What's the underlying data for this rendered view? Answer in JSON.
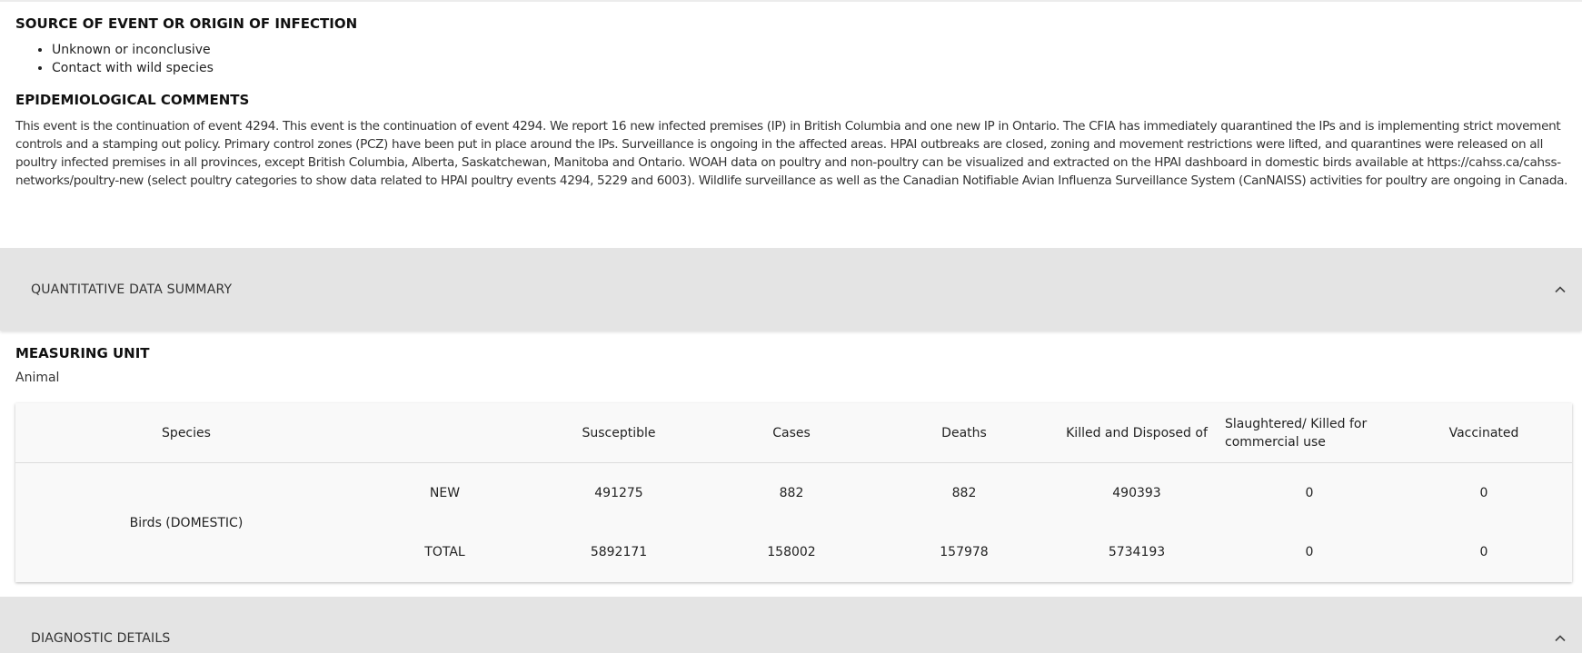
{
  "origin": {
    "title": "SOURCE OF EVENT OR ORIGIN OF INFECTION",
    "items": [
      "Unknown or inconclusive",
      "Contact with wild species"
    ]
  },
  "epidemiology": {
    "title": "EPIDEMIOLOGICAL COMMENTS",
    "text": "This event is the continuation of event 4294. This event is the continuation of event 4294. We report 16 new infected premises (IP) in British Columbia and one new IP in Ontario. The CFIA has immediately quarantined the IPs and is implementing strict movement controls and a stamping out policy. Primary control zones (PCZ) have been put in place around the IPs. Surveillance is ongoing in the affected areas. HPAI outbreaks are closed, zoning and movement restrictions were lifted, and quarantines were released on all poultry infected premises in all provinces, except British Columbia, Alberta, Saskatchewan, Manitoba and Ontario. WOAH data on poultry and non-poultry can be visualized and extracted on the HPAI dashboard in domestic birds available at https://cahss.ca/cahss-networks/poultry-new (select poultry categories to show data related to HPAI poultry events 4294, 5229 and 6003). Wildlife surveillance as well as the Canadian Notifiable Avian Influenza Surveillance System (CanNAISS) activities for poultry are ongoing in Canada."
  },
  "quantitative": {
    "section_label": "QUANTITATIVE DATA SUMMARY",
    "measuring_unit_title": "MEASURING UNIT",
    "measuring_unit_value": "Animal",
    "table": {
      "headers": {
        "species": "Species",
        "susceptible": "Susceptible",
        "cases": "Cases",
        "deaths": "Deaths",
        "killed": "Killed and Disposed of",
        "slaughtered": "Slaughtered/ Killed for commercial use",
        "vaccinated": "Vaccinated"
      },
      "species": "Birds (DOMESTIC)",
      "rows": [
        {
          "label": "NEW",
          "susceptible": "491275",
          "cases": "882",
          "deaths": "882",
          "killed": "490393",
          "slaughtered": "0",
          "vaccinated": "0"
        },
        {
          "label": "TOTAL",
          "susceptible": "5892171",
          "cases": "158002",
          "deaths": "157978",
          "killed": "5734193",
          "slaughtered": "0",
          "vaccinated": "0"
        }
      ]
    }
  },
  "diagnostic": {
    "section_label": "DIAGNOSTIC DETAILS"
  },
  "icons": {
    "collapse": "chevron-up-icon"
  },
  "colors": {
    "accordion_bg": "#e4e4e4",
    "table_bg": "#f9f9f9"
  }
}
